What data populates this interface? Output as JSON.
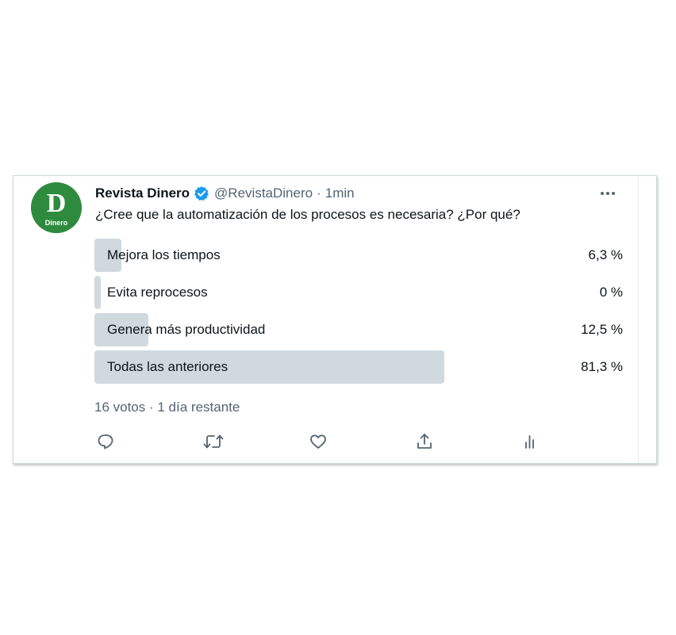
{
  "tweet": {
    "display_name": "Revista Dinero",
    "handle": "@RevistaDinero",
    "separator": "·",
    "time": "1min",
    "text": "¿Cree que la automatización de los procesos es necesaria? ¿Por qué?",
    "avatar": {
      "letter": "D",
      "caption": "Dinero",
      "color": "#2e8b3e"
    },
    "more_icon": "more-horizontal-icon"
  },
  "poll": {
    "options": [
      {
        "label": "Mejora los tiempos",
        "percent_text": "6,3 %",
        "percent": 6.3
      },
      {
        "label": "Evita reprocesos",
        "percent_text": "0 %",
        "percent": 0
      },
      {
        "label": "Genera más productividad",
        "percent_text": "12,5 %",
        "percent": 12.5
      },
      {
        "label": "Todas las anteriores",
        "percent_text": "81,3 %",
        "percent": 81.3
      }
    ],
    "footer": "16 votos · 1 día restante",
    "bar_color": "#cfd9de"
  },
  "actions": {
    "icons": [
      "reply-icon",
      "retweet-icon",
      "like-icon",
      "share-icon",
      "analytics-icon"
    ],
    "icon_color": "#536471"
  },
  "colors": {
    "verified": "#1d9bf0",
    "secondary_text": "#536471",
    "primary_text": "#0f1419"
  }
}
